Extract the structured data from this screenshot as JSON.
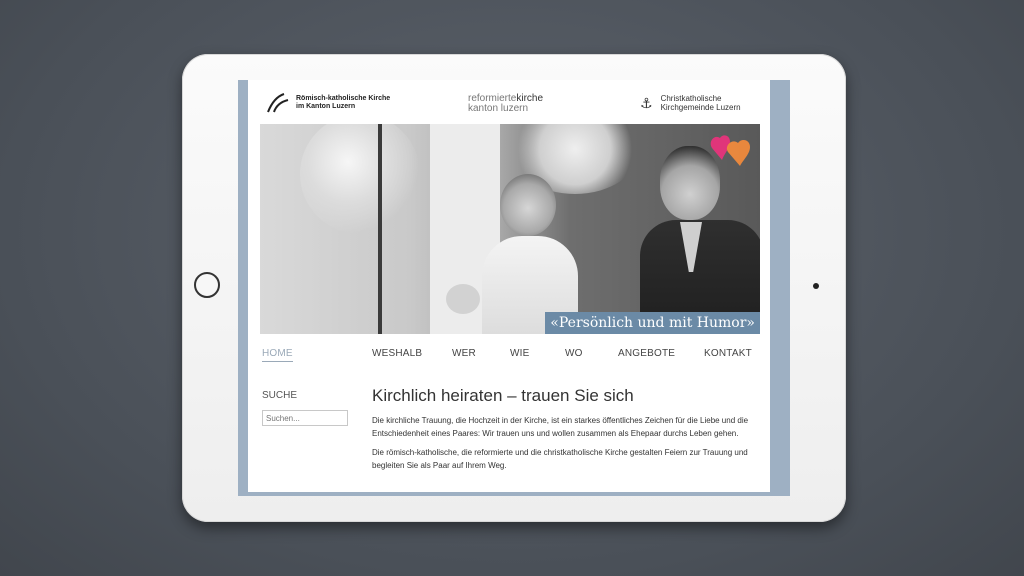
{
  "header": {
    "logo_rk_line1": "Römisch-katholische Kirche",
    "logo_rk_line2": "im Kanton Luzern",
    "logo_ref_part1": "reformierte",
    "logo_ref_part2": "kirche",
    "logo_ref_line2": "kanton luzern",
    "logo_ck_line1": "Christkatholische",
    "logo_ck_line2": "Kirchgemeinde Luzern"
  },
  "hero": {
    "caption": "«Persönlich und mit Humor»"
  },
  "nav": {
    "items": [
      "HOME",
      "WESHALB",
      "WER",
      "WIE",
      "WO",
      "ANGEBOTE",
      "KONTAKT"
    ],
    "active": "HOME"
  },
  "sidebar": {
    "search_title": "SUCHE",
    "search_placeholder": "Suchen..."
  },
  "main": {
    "title": "Kirchlich heiraten – trauen Sie sich",
    "paragraph1": "Die kirchliche Trauung, die Hochzeit in der Kirche, ist ein starkes öffentliches Zeichen für die Liebe und die Entschiedenheit eines Paares: Wir trauen uns und wollen zusammen als Ehepaar durchs Leben gehen.",
    "paragraph2": "Die römisch-katholische, die reformierte und die christkatholische Kirche gestalten Feiern zur Trauung und begleiten Sie als Paar auf Ihrem Weg."
  },
  "colors": {
    "accent_blue": "#6b8aa6",
    "screen_border": "#9eb0c3",
    "heart_pink": "#e0357a",
    "heart_orange": "#f08a3c"
  }
}
